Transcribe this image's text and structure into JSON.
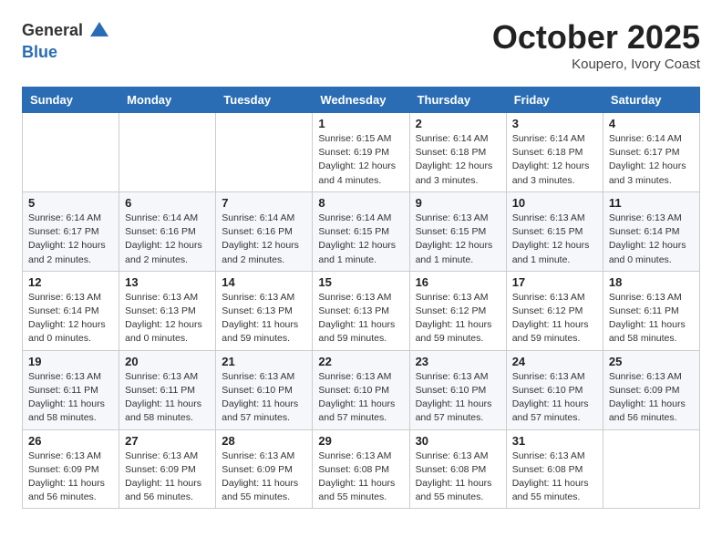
{
  "logo": {
    "general": "General",
    "blue": "Blue"
  },
  "header": {
    "title": "October 2025",
    "location": "Koupero, Ivory Coast"
  },
  "days_of_week": [
    "Sunday",
    "Monday",
    "Tuesday",
    "Wednesday",
    "Thursday",
    "Friday",
    "Saturday"
  ],
  "weeks": [
    [
      {
        "day": "",
        "info": ""
      },
      {
        "day": "",
        "info": ""
      },
      {
        "day": "",
        "info": ""
      },
      {
        "day": "1",
        "info": "Sunrise: 6:15 AM\nSunset: 6:19 PM\nDaylight: 12 hours\nand 4 minutes."
      },
      {
        "day": "2",
        "info": "Sunrise: 6:14 AM\nSunset: 6:18 PM\nDaylight: 12 hours\nand 3 minutes."
      },
      {
        "day": "3",
        "info": "Sunrise: 6:14 AM\nSunset: 6:18 PM\nDaylight: 12 hours\nand 3 minutes."
      },
      {
        "day": "4",
        "info": "Sunrise: 6:14 AM\nSunset: 6:17 PM\nDaylight: 12 hours\nand 3 minutes."
      }
    ],
    [
      {
        "day": "5",
        "info": "Sunrise: 6:14 AM\nSunset: 6:17 PM\nDaylight: 12 hours\nand 2 minutes."
      },
      {
        "day": "6",
        "info": "Sunrise: 6:14 AM\nSunset: 6:16 PM\nDaylight: 12 hours\nand 2 minutes."
      },
      {
        "day": "7",
        "info": "Sunrise: 6:14 AM\nSunset: 6:16 PM\nDaylight: 12 hours\nand 2 minutes."
      },
      {
        "day": "8",
        "info": "Sunrise: 6:14 AM\nSunset: 6:15 PM\nDaylight: 12 hours\nand 1 minute."
      },
      {
        "day": "9",
        "info": "Sunrise: 6:13 AM\nSunset: 6:15 PM\nDaylight: 12 hours\nand 1 minute."
      },
      {
        "day": "10",
        "info": "Sunrise: 6:13 AM\nSunset: 6:15 PM\nDaylight: 12 hours\nand 1 minute."
      },
      {
        "day": "11",
        "info": "Sunrise: 6:13 AM\nSunset: 6:14 PM\nDaylight: 12 hours\nand 0 minutes."
      }
    ],
    [
      {
        "day": "12",
        "info": "Sunrise: 6:13 AM\nSunset: 6:14 PM\nDaylight: 12 hours\nand 0 minutes."
      },
      {
        "day": "13",
        "info": "Sunrise: 6:13 AM\nSunset: 6:13 PM\nDaylight: 12 hours\nand 0 minutes."
      },
      {
        "day": "14",
        "info": "Sunrise: 6:13 AM\nSunset: 6:13 PM\nDaylight: 11 hours\nand 59 minutes."
      },
      {
        "day": "15",
        "info": "Sunrise: 6:13 AM\nSunset: 6:13 PM\nDaylight: 11 hours\nand 59 minutes."
      },
      {
        "day": "16",
        "info": "Sunrise: 6:13 AM\nSunset: 6:12 PM\nDaylight: 11 hours\nand 59 minutes."
      },
      {
        "day": "17",
        "info": "Sunrise: 6:13 AM\nSunset: 6:12 PM\nDaylight: 11 hours\nand 59 minutes."
      },
      {
        "day": "18",
        "info": "Sunrise: 6:13 AM\nSunset: 6:11 PM\nDaylight: 11 hours\nand 58 minutes."
      }
    ],
    [
      {
        "day": "19",
        "info": "Sunrise: 6:13 AM\nSunset: 6:11 PM\nDaylight: 11 hours\nand 58 minutes."
      },
      {
        "day": "20",
        "info": "Sunrise: 6:13 AM\nSunset: 6:11 PM\nDaylight: 11 hours\nand 58 minutes."
      },
      {
        "day": "21",
        "info": "Sunrise: 6:13 AM\nSunset: 6:10 PM\nDaylight: 11 hours\nand 57 minutes."
      },
      {
        "day": "22",
        "info": "Sunrise: 6:13 AM\nSunset: 6:10 PM\nDaylight: 11 hours\nand 57 minutes."
      },
      {
        "day": "23",
        "info": "Sunrise: 6:13 AM\nSunset: 6:10 PM\nDaylight: 11 hours\nand 57 minutes."
      },
      {
        "day": "24",
        "info": "Sunrise: 6:13 AM\nSunset: 6:10 PM\nDaylight: 11 hours\nand 57 minutes."
      },
      {
        "day": "25",
        "info": "Sunrise: 6:13 AM\nSunset: 6:09 PM\nDaylight: 11 hours\nand 56 minutes."
      }
    ],
    [
      {
        "day": "26",
        "info": "Sunrise: 6:13 AM\nSunset: 6:09 PM\nDaylight: 11 hours\nand 56 minutes."
      },
      {
        "day": "27",
        "info": "Sunrise: 6:13 AM\nSunset: 6:09 PM\nDaylight: 11 hours\nand 56 minutes."
      },
      {
        "day": "28",
        "info": "Sunrise: 6:13 AM\nSunset: 6:09 PM\nDaylight: 11 hours\nand 55 minutes."
      },
      {
        "day": "29",
        "info": "Sunrise: 6:13 AM\nSunset: 6:08 PM\nDaylight: 11 hours\nand 55 minutes."
      },
      {
        "day": "30",
        "info": "Sunrise: 6:13 AM\nSunset: 6:08 PM\nDaylight: 11 hours\nand 55 minutes."
      },
      {
        "day": "31",
        "info": "Sunrise: 6:13 AM\nSunset: 6:08 PM\nDaylight: 11 hours\nand 55 minutes."
      },
      {
        "day": "",
        "info": ""
      }
    ]
  ]
}
